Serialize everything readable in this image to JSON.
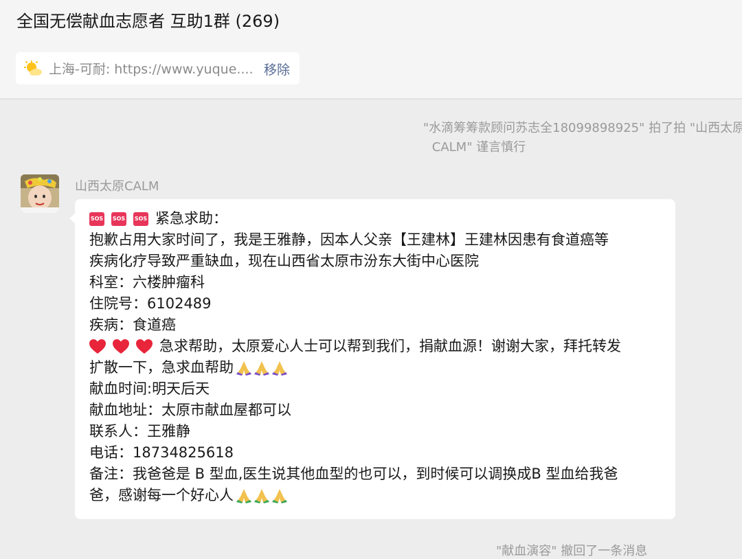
{
  "chat": {
    "title": "全国无偿献血志愿者 互助1群 (269)"
  },
  "pinned": {
    "text": "上海-可耐: https://www.yuque....",
    "remove_label": "移除",
    "icon": "sun-cloud-icon"
  },
  "system_messages": {
    "nudge_line1": "\"水滴筹筹款顾问苏志全18099898925\" 拍了拍 \"山西太原",
    "nudge_line2": "CALM\" 谨言慎行",
    "recall": "\"献血演容\" 撤回了一条消息"
  },
  "message": {
    "sender": "山西太原CALM",
    "lines": [
      "紧急求助：",
      "抱歉占用大家时间了，我是王雅静，因本人父亲【王建林】王建林因患有食道癌等",
      "疾病化疗导致严重缺血，现在山西省太原市汾东大街中心医院",
      "科室：六楼肿瘤科",
      "住院号：6102489",
      "疾病：食道癌",
      "急求帮助，太原爱心人士可以帮到我们，捐献血源！谢谢大家，拜托转发",
      "扩散一下，急求血帮助",
      "献血时间:明天后天",
      "献血地址：太原市献血屋都可以",
      "联系人：王雅静",
      "电话：18734825618",
      "备注：我爸爸是 B 型血,医生说其他血型的也可以，到时候可以调换成B 型血给我爸",
      "爸，感谢每一个好心人"
    ],
    "emoji": {
      "sos_label": "SOS",
      "sos": "sos-icon",
      "heart": "heart-icon",
      "pray_purple": "pray-purple-icon",
      "pray_yellow": "pray-yellow-icon"
    }
  },
  "colors": {
    "background": "#ededed",
    "header_bg": "#f5f5f5",
    "link": "#576b95",
    "sos_red": "#e8365a",
    "system_text": "#9a9a9a"
  }
}
